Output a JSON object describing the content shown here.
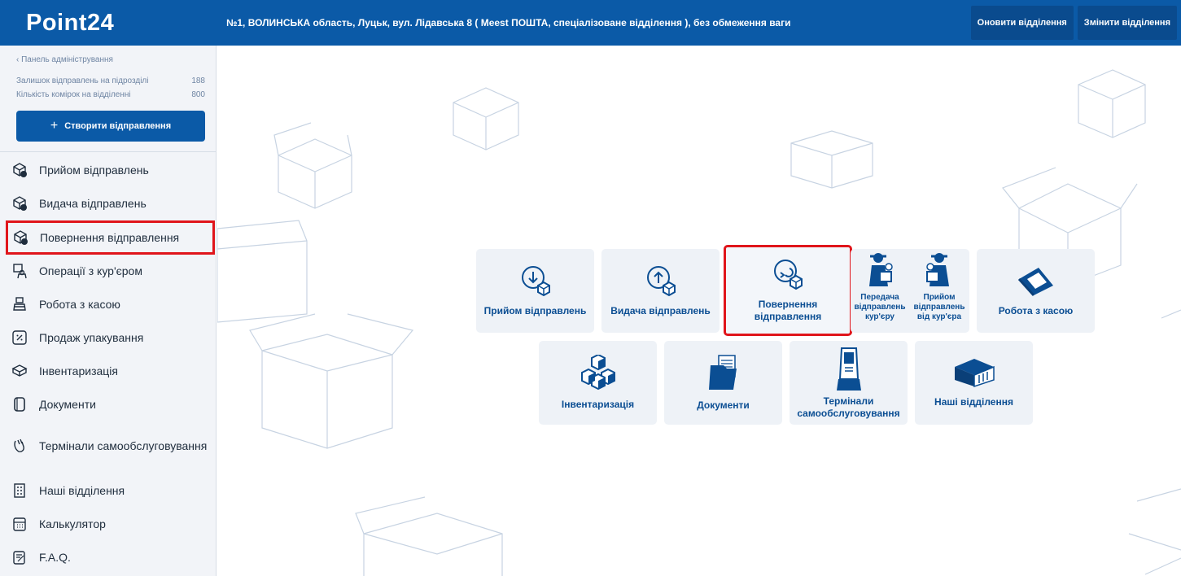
{
  "header": {
    "logo": "Point24",
    "location": "№1, ВОЛИНСЬКА область, Луцьк, вул. Лідавська 8 ( Meest ПОШТА, спеціалізоване відділення ), без обмеження ваги",
    "refresh_label": "Оновити відділення",
    "change_label": "Змінити відділення"
  },
  "sidebar": {
    "back_label": "Панель адміністрування",
    "stats": [
      {
        "label": "Залишок відправлень на підрозділі",
        "value": "188"
      },
      {
        "label": "Кількість комірок на відділенні",
        "value": "800"
      }
    ],
    "create_label": "Створити відправлення",
    "items": [
      {
        "label": "Прийом відправлень",
        "icon": "box-receive-icon"
      },
      {
        "label": "Видача відправлень",
        "icon": "box-issue-icon"
      },
      {
        "label": "Повернення відправлення",
        "icon": "box-return-icon"
      },
      {
        "label": "Операції з кур'єром",
        "icon": "courier-icon"
      },
      {
        "label": "Робота з касою",
        "icon": "cash-register-icon"
      },
      {
        "label": "Продаж упакування",
        "icon": "percent-icon"
      },
      {
        "label": "Інвентаризація",
        "icon": "inventory-icon"
      },
      {
        "label": "Документи",
        "icon": "documents-icon"
      },
      {
        "label": "Термінали самообслуговування",
        "icon": "terminal-icon"
      },
      {
        "label": "Наші відділення",
        "icon": "building-icon"
      },
      {
        "label": "Калькулятор",
        "icon": "calculator-icon"
      },
      {
        "label": "F.A.Q.",
        "icon": "faq-icon"
      }
    ]
  },
  "tiles": {
    "receive": "Прийом відправлень",
    "issue": "Видача відправлень",
    "return": "Повернення відправлення",
    "courier_handover": "Передача відправлень кур'єру",
    "courier_receive": "Прийом відправлень від кур'єра",
    "cash": "Робота з касою",
    "inventory": "Інвентаризація",
    "documents": "Документи",
    "terminals": "Термінали самообслуговування",
    "branches": "Наші відділення"
  },
  "colors": {
    "brand": "#0b5aa7",
    "highlight": "#e0151b",
    "sidebar_bg": "#f2f4f8",
    "tile_bg": "#eef2f7"
  }
}
